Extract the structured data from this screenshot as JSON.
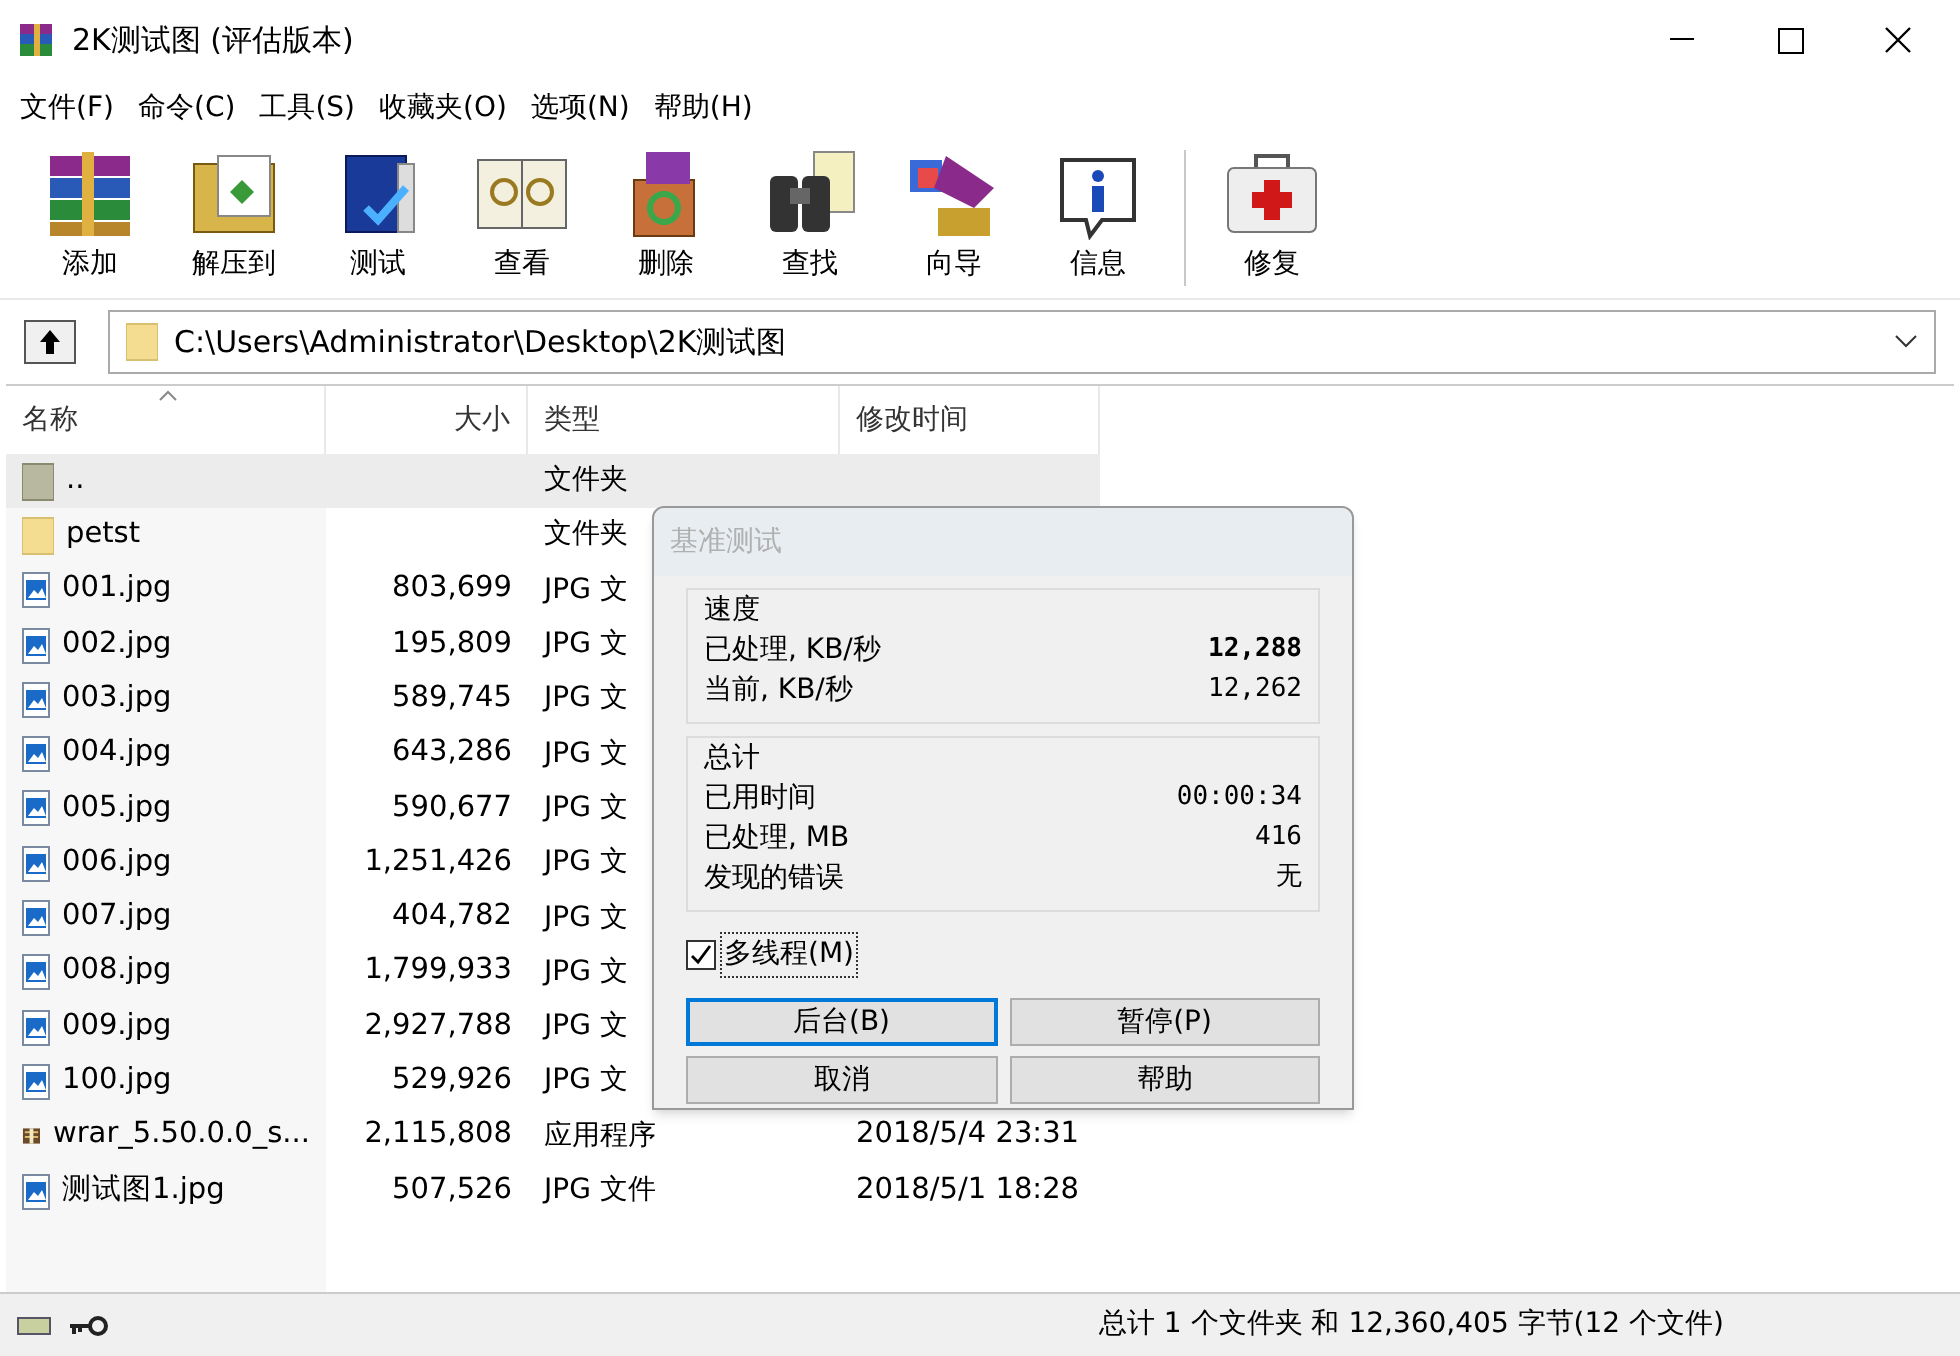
{
  "window": {
    "title": "2K测试图 (评估版本)"
  },
  "menu": [
    "文件(F)",
    "命令(C)",
    "工具(S)",
    "收藏夹(O)",
    "选项(N)",
    "帮助(H)"
  ],
  "toolbar": [
    {
      "label": "添加",
      "kind": "add"
    },
    {
      "label": "解压到",
      "kind": "extract"
    },
    {
      "label": "测试",
      "kind": "test"
    },
    {
      "label": "查看",
      "kind": "view"
    },
    {
      "label": "删除",
      "kind": "delete"
    },
    {
      "label": "查找",
      "kind": "find"
    },
    {
      "label": "向导",
      "kind": "wizard"
    },
    {
      "label": "信息",
      "kind": "info"
    },
    {
      "label": "修复",
      "kind": "repair"
    }
  ],
  "address": {
    "value": "C:\\Users\\Administrator\\Desktop\\2K测试图"
  },
  "table": {
    "columns": [
      "名称",
      "大小",
      "类型",
      "修改时间"
    ],
    "rows": [
      {
        "kind": "up",
        "name": "..",
        "size": "",
        "type": "文件夹",
        "selected": true
      },
      {
        "kind": "folder",
        "name": "petst",
        "size": "",
        "type": "文件夹",
        "selected": false
      },
      {
        "kind": "image",
        "name": "001.jpg",
        "size": "803,699",
        "type": "JPG 文",
        "selected": false
      },
      {
        "kind": "image",
        "name": "002.jpg",
        "size": "195,809",
        "type": "JPG 文",
        "selected": false
      },
      {
        "kind": "image",
        "name": "003.jpg",
        "size": "589,745",
        "type": "JPG 文",
        "selected": false
      },
      {
        "kind": "image",
        "name": "004.jpg",
        "size": "643,286",
        "type": "JPG 文",
        "selected": false
      },
      {
        "kind": "image",
        "name": "005.jpg",
        "size": "590,677",
        "type": "JPG 文",
        "selected": false
      },
      {
        "kind": "image",
        "name": "006.jpg",
        "size": "1,251,426",
        "type": "JPG 文",
        "selected": false
      },
      {
        "kind": "image",
        "name": "007.jpg",
        "size": "404,782",
        "type": "JPG 文",
        "selected": false
      },
      {
        "kind": "image",
        "name": "008.jpg",
        "size": "1,799,933",
        "type": "JPG 文",
        "selected": false
      },
      {
        "kind": "image",
        "name": "009.jpg",
        "size": "2,927,788",
        "type": "JPG 文",
        "selected": false
      },
      {
        "kind": "image",
        "name": "100.jpg",
        "size": "529,926",
        "type": "JPG 文",
        "selected": false
      },
      {
        "kind": "archive",
        "name": "wrar_5.50.0.0_s...",
        "size": "2,115,808",
        "type": "应用程序",
        "modified": "2018/5/4 23:31",
        "selected": false
      },
      {
        "kind": "image",
        "name": "测试图1.jpg",
        "size": "507,526",
        "type": "JPG 文件",
        "modified": "2018/5/1 18:28",
        "selected": false
      }
    ]
  },
  "dialog": {
    "title": "基准测试",
    "groups": [
      {
        "title": "速度",
        "rows": [
          {
            "label": "已处理, KB/秒",
            "value": "12,288",
            "bold": true
          },
          {
            "label": "当前, KB/秒",
            "value": "12,262",
            "bold": false
          }
        ]
      },
      {
        "title": "总计",
        "rows": [
          {
            "label": "已用时间",
            "value": "00:00:34",
            "bold": false
          },
          {
            "label": "已处理, MB",
            "value": "416",
            "bold": false
          },
          {
            "label": "发现的错误",
            "value": "无",
            "bold": false
          }
        ]
      }
    ],
    "checkbox": {
      "label": "多线程(M)",
      "checked": true
    },
    "buttons": [
      {
        "label": "后台(B)",
        "focused": true
      },
      {
        "label": "暂停(P)",
        "focused": false
      },
      {
        "label": "取消",
        "focused": false
      },
      {
        "label": "帮助",
        "focused": false
      }
    ]
  },
  "status_bar": {
    "text": "总计 1 个文件夹 和 12,360,405 字节(12 个文件)"
  }
}
